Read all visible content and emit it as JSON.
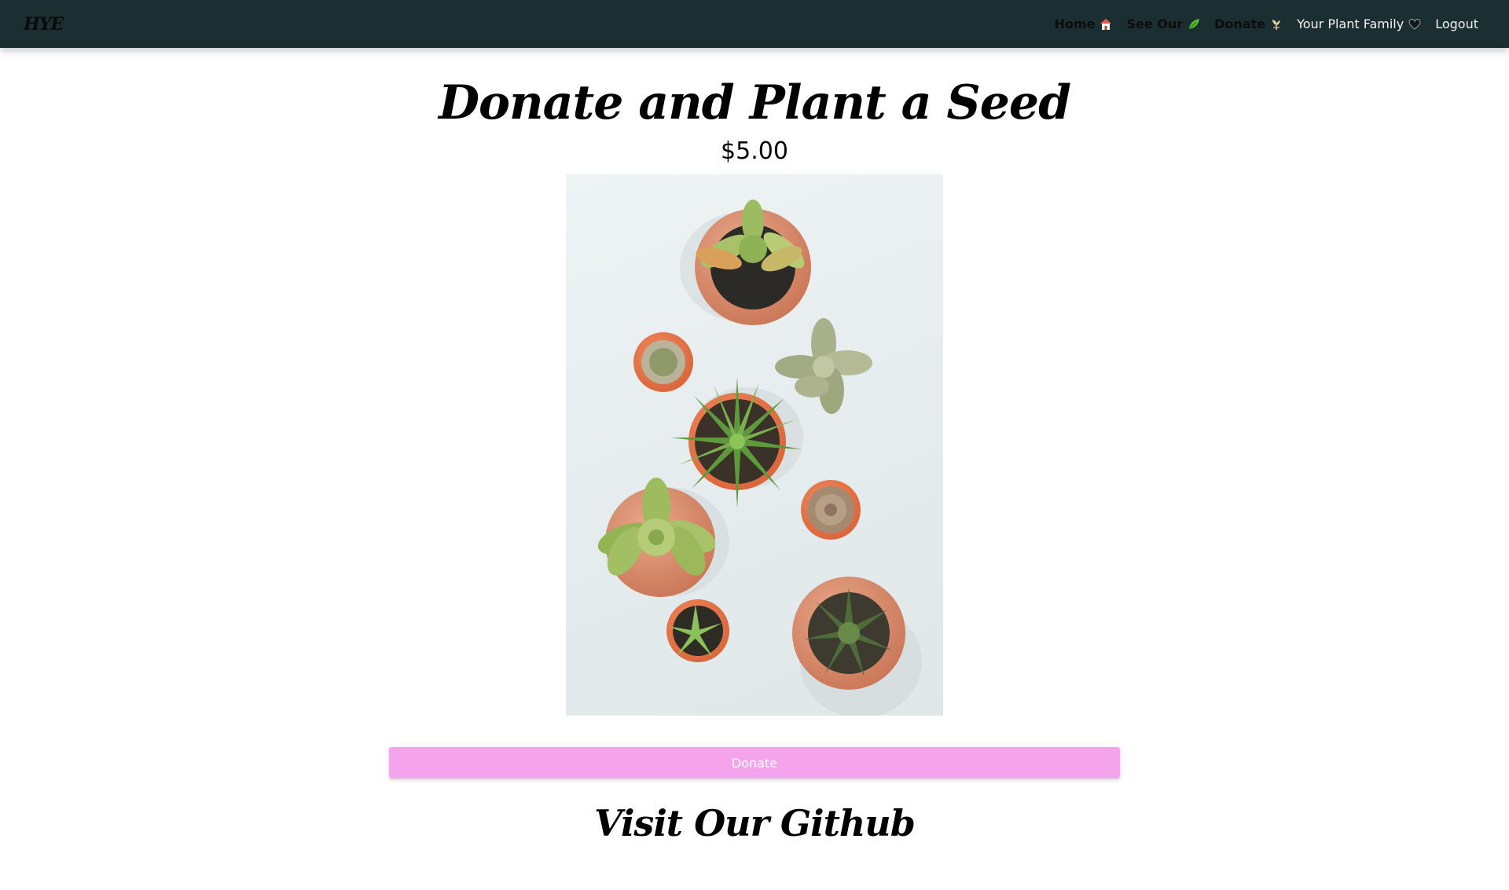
{
  "colors": {
    "navbar_bg": "#1b2e31",
    "brand_text": "#0a0a0a",
    "nav_bold_text": "#0d0d0d",
    "nav_light_text": "#f3f3f3",
    "button_bg": "#f5a4ec",
    "button_text": "#ffffff"
  },
  "navbar": {
    "brand": "HYE",
    "links": [
      {
        "label": "Home",
        "icon": "house-icon"
      },
      {
        "label": "See Our",
        "icon": "leaf-icon"
      },
      {
        "label": "Donate",
        "icon": "seedling-icon"
      },
      {
        "label": "Your Plant Family",
        "icon": "heart-icon"
      },
      {
        "label": "Logout",
        "icon": ""
      }
    ]
  },
  "main": {
    "title": "Donate and Plant a Seed",
    "price": "$5.00",
    "image_subject": "potted succulents and cacti",
    "donate_button": "Donate",
    "github_heading": "Visit Our Github"
  }
}
